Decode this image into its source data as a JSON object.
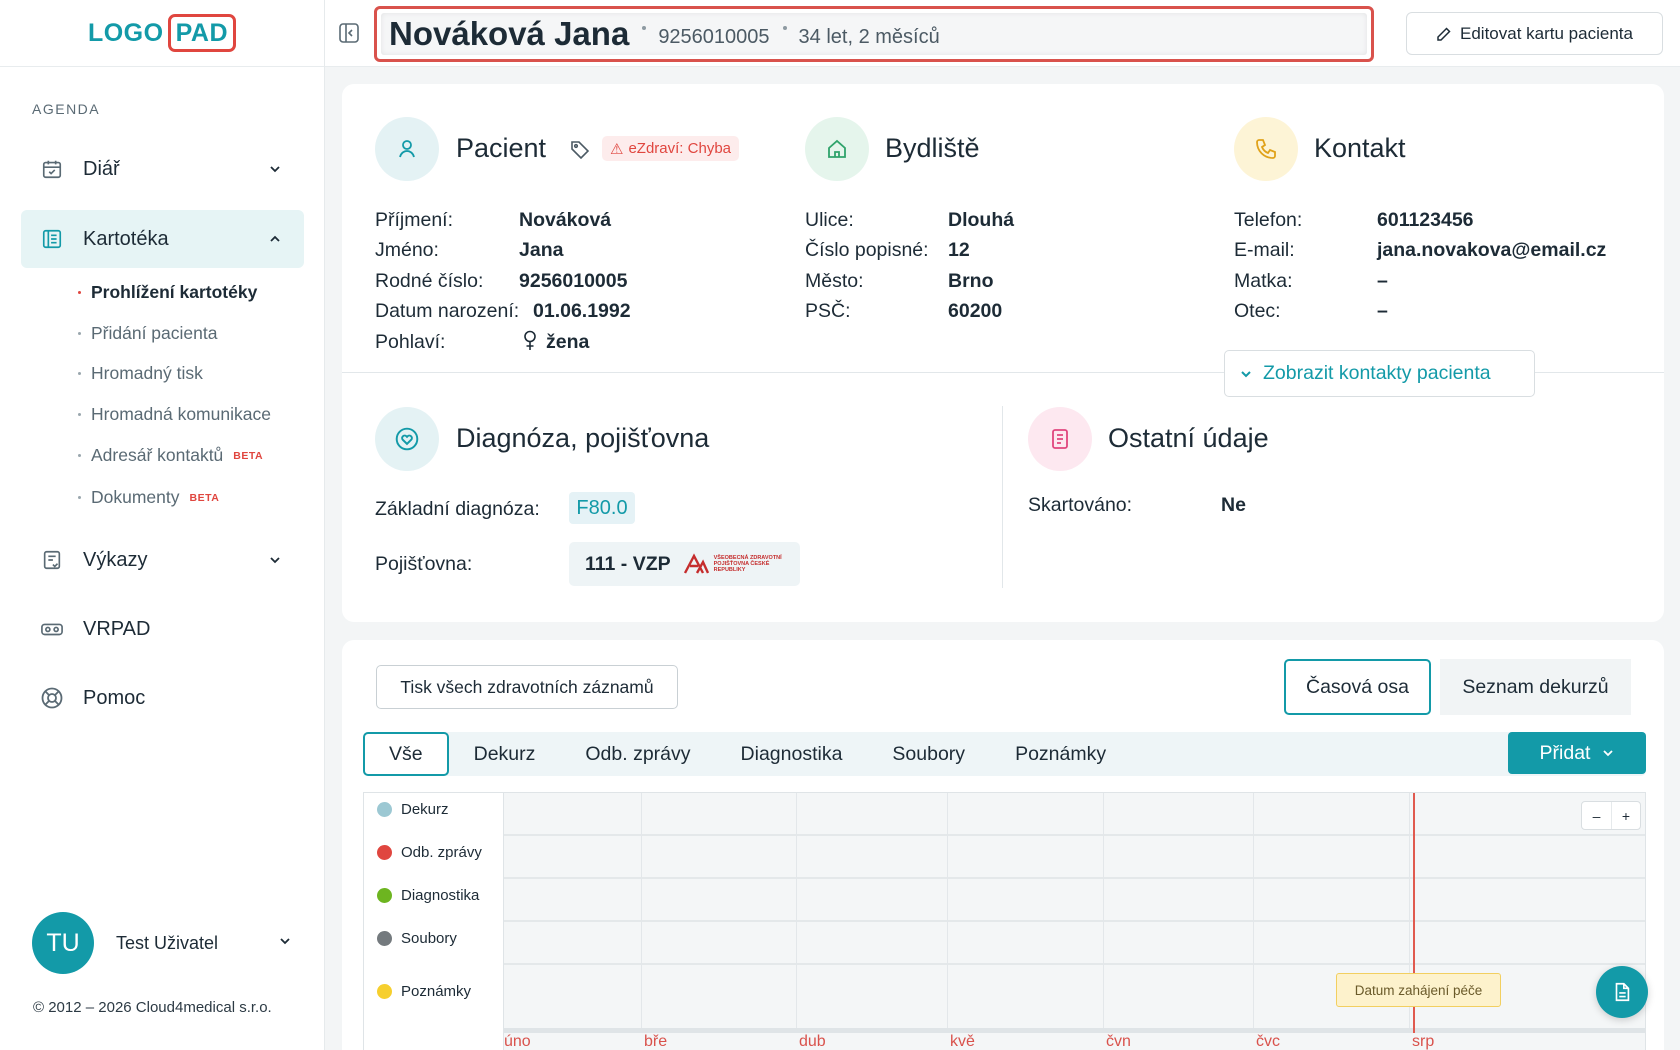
{
  "brand": {
    "logo_left": "LOGO",
    "logo_right": "PAD",
    "accent": "#139aa8",
    "logo_border": "#e0463f"
  },
  "sidebar": {
    "section_label": "AGENDA",
    "items": [
      {
        "label": "Diář",
        "icon": "calendar-icon"
      },
      {
        "label": "Kartotéka",
        "icon": "file-list-icon"
      },
      {
        "label": "Výkazy",
        "icon": "report-icon"
      },
      {
        "label": "VRPAD",
        "icon": "vr-headset-icon"
      },
      {
        "label": "Pomoc",
        "icon": "lifebuoy-icon"
      }
    ],
    "sub_items": [
      {
        "label": "Prohlížení kartotéky",
        "beta": ""
      },
      {
        "label": "Přidání pacienta",
        "beta": ""
      },
      {
        "label": "Hromadný tisk",
        "beta": ""
      },
      {
        "label": "Hromadná komunikace",
        "beta": ""
      },
      {
        "label": "Adresář kontaktů",
        "beta": "BETA"
      },
      {
        "label": "Dokumenty",
        "beta": "BETA"
      }
    ],
    "user": {
      "initials": "TU",
      "name": "Test Uživatel"
    },
    "copyright": "© 2012 – 2026 Cloud4medical s.r.o."
  },
  "header": {
    "patient_name": "Nováková Jana",
    "birth_number": "9256010005",
    "age": "34 let, 2 měsíců",
    "edit_button": "Editovat kartu pacienta"
  },
  "patient": {
    "title": "Pacient",
    "ezdravi_badge": "eZdraví: Chyba",
    "fields": [
      {
        "label": "Příjmení:",
        "value": "Nováková"
      },
      {
        "label": "Jméno:",
        "value": "Jana"
      },
      {
        "label": "Rodné číslo:",
        "value": "9256010005"
      },
      {
        "label": "Datum narození:",
        "value": "01.06.1992"
      },
      {
        "label": "Pohlaví:",
        "value": "žena"
      }
    ]
  },
  "address": {
    "title": "Bydliště",
    "fields": [
      {
        "label": "Ulice:",
        "value": "Dlouhá"
      },
      {
        "label": "Číslo popisné:",
        "value": "12"
      },
      {
        "label": "Město:",
        "value": "Brno"
      },
      {
        "label": "PSČ:",
        "value": "60200"
      }
    ]
  },
  "contact": {
    "title": "Kontakt",
    "fields": [
      {
        "label": "Telefon:",
        "value": "601123456"
      },
      {
        "label": "E-mail:",
        "value": "jana.novakova@email.cz"
      },
      {
        "label": "Matka:",
        "value": "–"
      },
      {
        "label": "Otec:",
        "value": "–"
      }
    ],
    "show_contacts_button": "Zobrazit kontakty pacienta"
  },
  "diagnosis": {
    "title": "Diagnóza, pojišťovna",
    "diagnosis_label": "Základní diagnóza:",
    "diagnosis_code": "F80.0",
    "insurer_label": "Pojišťovna:",
    "insurer_value": "111 - VZP",
    "insurer_logo_text": "VŠEOBECNÁ ZDRAVOTNÍ POJIŠŤOVNA ČESKÉ REPUBLIKY"
  },
  "other": {
    "title": "Ostatní údaje",
    "shredded_label": "Skartováno:",
    "shredded_value": "Ne"
  },
  "records": {
    "print_button": "Tisk všech zdravotních záznamů",
    "view_timeline": "Časová osa",
    "view_list": "Seznam dekurzů",
    "tabs": [
      "Vše",
      "Dekurz",
      "Odb. zprávy",
      "Diagnostika",
      "Soubory",
      "Poznámky"
    ],
    "add_button": "Přidat"
  },
  "timeline": {
    "rows": [
      {
        "label": "Dekurz",
        "color": "#9cc8d3"
      },
      {
        "label": "Odb. zprávy",
        "color": "#e0463f"
      },
      {
        "label": "Diagnostika",
        "color": "#6db520"
      },
      {
        "label": "Soubory",
        "color": "#747a7e"
      },
      {
        "label": "Poznámky",
        "color": "#f6cf2e"
      }
    ],
    "months": [
      "úno",
      "bře",
      "dub",
      "kvě",
      "čvn",
      "čvc",
      "srp"
    ],
    "zoom_out": "–",
    "zoom_in": "+",
    "care_start_label": "Datum zahájení péče"
  }
}
